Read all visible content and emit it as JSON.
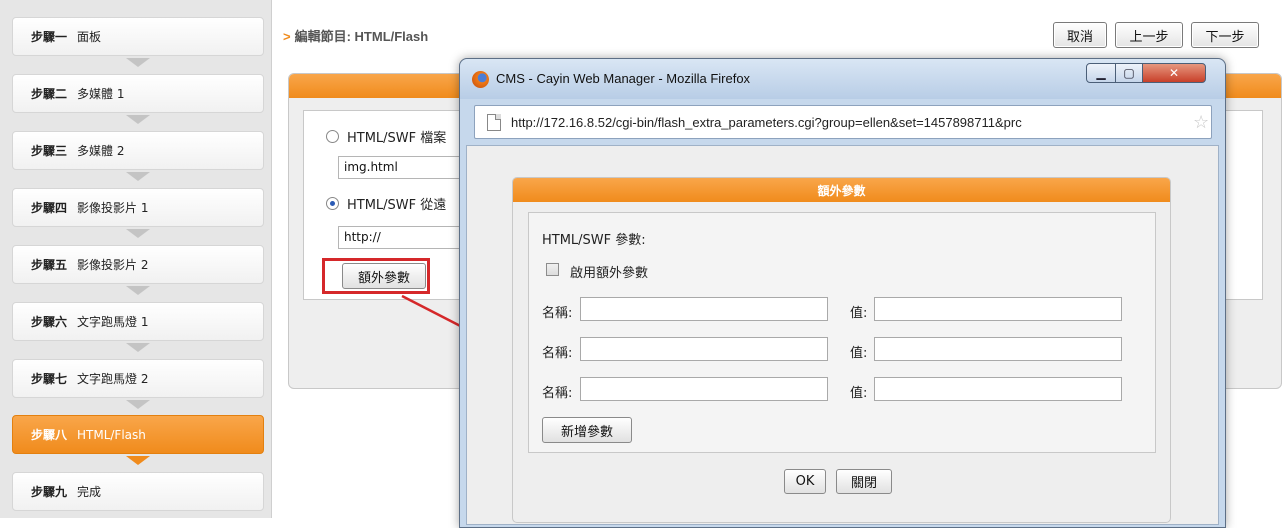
{
  "sidebar": {
    "steps": [
      {
        "num": "步驟一",
        "name": "面板"
      },
      {
        "num": "步驟二",
        "name": "多媒體 1"
      },
      {
        "num": "步驟三",
        "name": "多媒體 2"
      },
      {
        "num": "步驟四",
        "name": "影像投影片 1"
      },
      {
        "num": "步驟五",
        "name": "影像投影片 2"
      },
      {
        "num": "步驟六",
        "name": "文字跑馬燈 1"
      },
      {
        "num": "步驟七",
        "name": "文字跑馬燈 2"
      },
      {
        "num": "步驟八",
        "name": "HTML/Flash"
      },
      {
        "num": "步驟九",
        "name": "完成"
      }
    ],
    "active_step": "步驟八"
  },
  "header": {
    "breadcrumb_marker": ">",
    "breadcrumb": "編輯節目: HTML/Flash",
    "cancel": "取消",
    "prev": "上一步",
    "next": "下一步"
  },
  "main": {
    "option_file_label": "HTML/SWF 檔案",
    "file_value": "img.html",
    "option_url_label": "HTML/SWF 從遠",
    "url_value": "http://",
    "extra_params_button": "額外參數"
  },
  "popup": {
    "window_title": "CMS - Cayin Web Manager - Mozilla Firefox",
    "url": "http://172.16.8.52/cgi-bin/flash_extra_parameters.cgi?group=ellen&set=1457898711&prc",
    "dialog_title": "額外參數",
    "params_heading": "HTML/SWF 參數:",
    "enable_label": "啟用額外參數",
    "name_label": "名稱:",
    "value_label": "值:",
    "add_button": "新增參數",
    "ok_button": "OK",
    "close_button": "關閉",
    "rows": [
      {
        "name": "",
        "value": ""
      },
      {
        "name": "",
        "value": ""
      },
      {
        "name": "",
        "value": ""
      }
    ]
  },
  "colors": {
    "accent_orange": "#f08b1c",
    "highlight_red": "#d5282a"
  }
}
